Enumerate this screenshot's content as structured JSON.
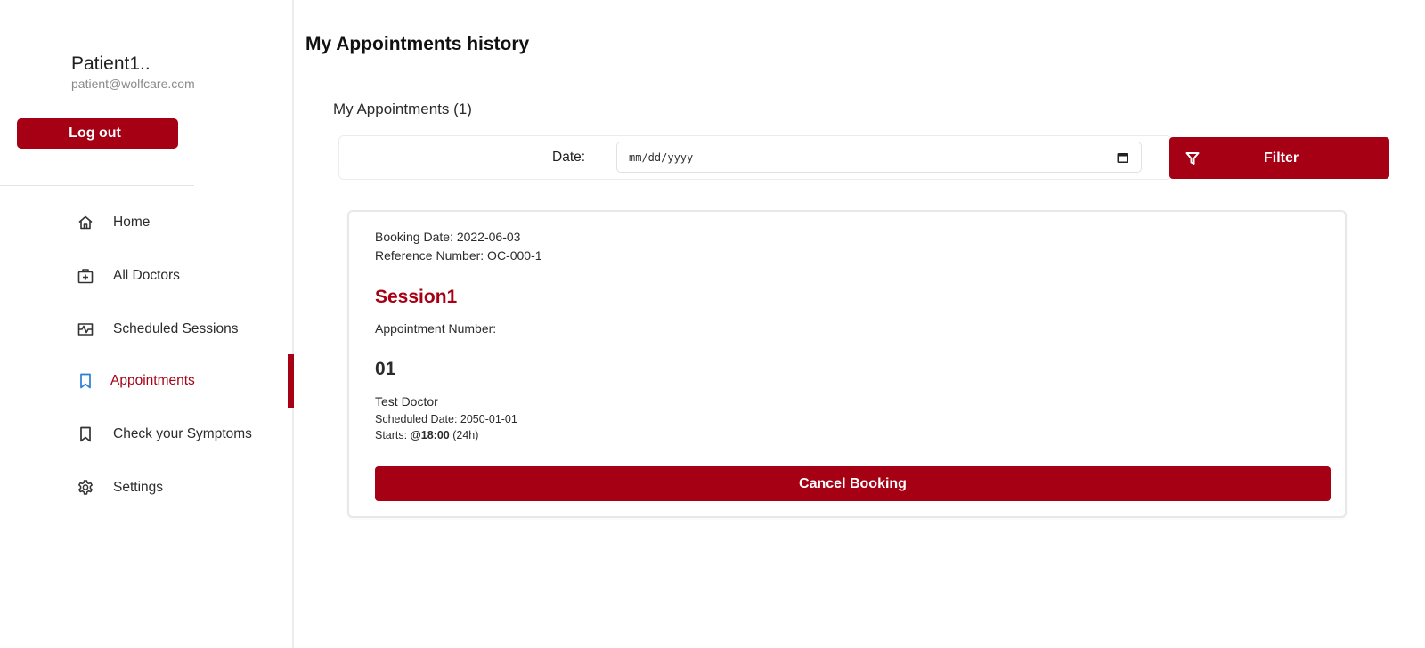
{
  "sidebar": {
    "profile": {
      "name": "Patient1..",
      "email": "patient@wolfcare.com"
    },
    "logout_label": "Log out",
    "nav": [
      {
        "label": "Home",
        "icon": "home-icon",
        "active": false
      },
      {
        "label": "All Doctors",
        "icon": "medical-kit-icon",
        "active": false
      },
      {
        "label": "Scheduled Sessions",
        "icon": "schedule-icon",
        "active": false
      },
      {
        "label": "Appointments",
        "icon": "bookmark-icon",
        "active": true
      },
      {
        "label": "Check your Symptoms",
        "icon": "bookmark-icon",
        "active": false
      },
      {
        "label": "Settings",
        "icon": "gear-icon",
        "active": false
      }
    ]
  },
  "main": {
    "title": "My Appointments history",
    "count_label": "My Appointments (1)",
    "filter": {
      "date_label": "Date:",
      "date_placeholder": "mm/dd/yyyy",
      "button_label": "Filter"
    },
    "appointment": {
      "booking_date": "Booking Date: 2022-06-03",
      "reference_number": "Reference Number: OC-000-1",
      "session_title": "Session1",
      "number_label": "Appointment Number:",
      "number_value": "01",
      "doctor": "Test Doctor",
      "scheduled_date": "Scheduled Date: 2050-01-01",
      "starts_prefix": "Starts: ",
      "starts_time": "@18:00",
      "starts_suffix": " (24h)",
      "cancel_label": "Cancel Booking"
    }
  },
  "colors": {
    "accent": "#a50013",
    "active_icon": "#2a7fd4"
  }
}
